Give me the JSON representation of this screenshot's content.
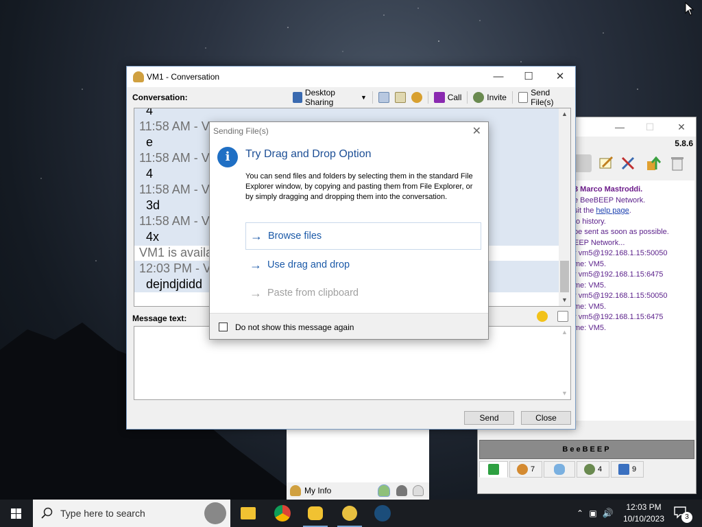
{
  "conversation_window": {
    "title": "VM1 - Conversation",
    "conversation_label": "Conversation:",
    "toolbar": {
      "desktop_sharing": "Desktop Sharing",
      "call": "Call",
      "invite": "Invite",
      "send_files": "Send File(s)"
    },
    "messages": [
      {
        "time": "4",
        "kind": "text"
      },
      {
        "time": "11:58 AM - VM5",
        "text": "e"
      },
      {
        "time": "11:58 AM - VM5",
        "text": "4"
      },
      {
        "time": "11:58 AM - VM5",
        "text": "3d"
      },
      {
        "time": "11:58 AM - VM5",
        "text": "4x"
      },
      {
        "status": "VM1 is available"
      },
      {
        "time": "12:03 PM - VM5",
        "text": "dejndjdidd"
      }
    ],
    "message_label": "Message text:",
    "send_button": "Send",
    "close_button": "Close"
  },
  "dialog": {
    "title": "Sending File(s)",
    "heading": "Try Drag and Drop Option",
    "body": "You can send files and folders by selecting them in the standard File Explorer window, by copying and pasting them from File Explorer, or by simply dragging and dropping them into the conversation.",
    "options": {
      "browse": "Browse files",
      "drag_drop": "Use drag and drop",
      "paste": "Paste from clipboard"
    },
    "checkbox_label": "Do not show this message again"
  },
  "beebeep_main": {
    "version": "5.8.6",
    "log": [
      {
        "cls": "name",
        "text": "3 Marco Mastroddi."
      },
      {
        "cls": "sys",
        "text": "e BeeBEEP Network."
      },
      {
        "cls": "sys",
        "pre": "sit the ",
        "link": "help page",
        "post": "."
      },
      {
        "cls": "sys",
        "text": " to history."
      },
      {
        "cls": "sys",
        "text": "be sent as soon as possible."
      },
      {
        "cls": "sys",
        "text": "EEP Network..."
      },
      {
        "cls": "sys",
        "text": "r vm5@192.168.1.15:50050"
      },
      {
        "cls": "sys",
        "text": "me: VM5."
      },
      {
        "cls": "sys",
        "text": "r vm5@192.168.1.15:6475"
      },
      {
        "cls": "sys",
        "text": "me: VM5."
      },
      {
        "cls": "sys",
        "text": "r vm5@192.168.1.15:50050"
      },
      {
        "cls": "sys",
        "text": "me: VM5."
      },
      {
        "cls": "sys",
        "text": "r vm5@192.168.1.15:6475"
      },
      {
        "cls": "sys",
        "text": "me: VM5."
      }
    ],
    "banner": "BeeBEEP",
    "tabs": {
      "users_count": "7",
      "groups_count": "4",
      "files_count": "9"
    }
  },
  "myinfo": {
    "label": "My Info"
  },
  "taskbar": {
    "search_placeholder": "Type here to search",
    "time": "12:03 PM",
    "date": "10/10/2023",
    "notification_count": "3"
  }
}
